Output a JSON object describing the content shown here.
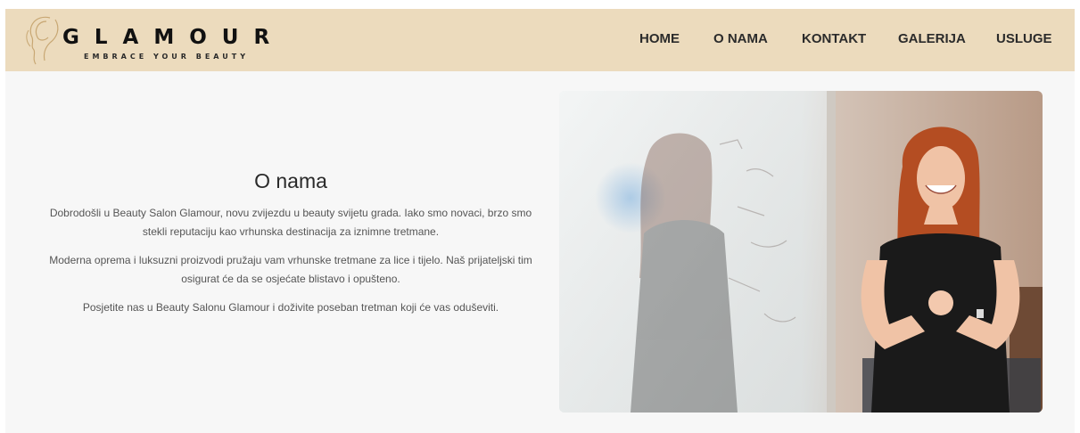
{
  "brand": {
    "name": "GLAMOUR",
    "tagline": "EMBRACE YOUR BEAUTY",
    "logo_icon": "woman-face-line-icon"
  },
  "nav": {
    "items": [
      {
        "label": "HOME"
      },
      {
        "label": "O NAMA"
      },
      {
        "label": "KONTAKT"
      },
      {
        "label": "GALERIJA"
      },
      {
        "label": "USLUGE"
      }
    ]
  },
  "about": {
    "title": "O nama",
    "paragraphs": [
      "Dobrodošli u Beauty Salon Glamour, novu zvijezdu u beauty svijetu grada. Iako smo novaci, brzo smo stekli reputaciju kao vrhunska destinacija za iznimne tretmane.",
      "Moderna oprema i luksuzni proizvodi pružaju vam vrhunske tretmane za lice i tijelo. Naš prijateljski tim osigurat će da se osjećate blistavo i opušteno.",
      "Posjetite nas u Beauty Salonu Glamour i doživite poseban tretman koji će vas oduševiti."
    ]
  },
  "photo": {
    "subject": "smiling woman with long red hair in a black sleeveless top standing by a glass whiteboard"
  },
  "colors": {
    "header_bg": "#ecdbbd",
    "section_bg": "#f7f7f7",
    "nav_text": "#2b2b2b",
    "hair": "#c0582a"
  }
}
